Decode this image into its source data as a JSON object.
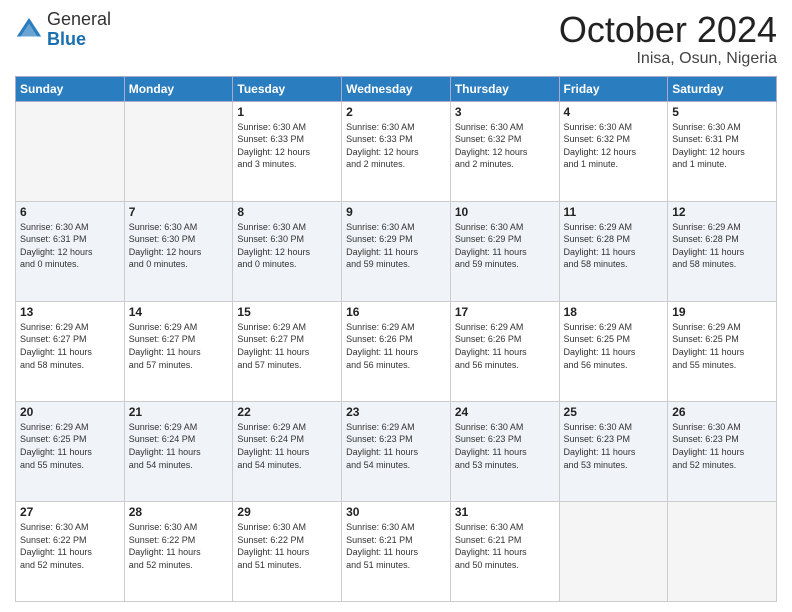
{
  "header": {
    "logo_general": "General",
    "logo_blue": "Blue",
    "title": "October 2024",
    "location": "Inisa, Osun, Nigeria"
  },
  "weekdays": [
    "Sunday",
    "Monday",
    "Tuesday",
    "Wednesday",
    "Thursday",
    "Friday",
    "Saturday"
  ],
  "weeks": [
    [
      {
        "num": "",
        "info": ""
      },
      {
        "num": "",
        "info": ""
      },
      {
        "num": "1",
        "info": "Sunrise: 6:30 AM\nSunset: 6:33 PM\nDaylight: 12 hours\nand 3 minutes."
      },
      {
        "num": "2",
        "info": "Sunrise: 6:30 AM\nSunset: 6:33 PM\nDaylight: 12 hours\nand 2 minutes."
      },
      {
        "num": "3",
        "info": "Sunrise: 6:30 AM\nSunset: 6:32 PM\nDaylight: 12 hours\nand 2 minutes."
      },
      {
        "num": "4",
        "info": "Sunrise: 6:30 AM\nSunset: 6:32 PM\nDaylight: 12 hours\nand 1 minute."
      },
      {
        "num": "5",
        "info": "Sunrise: 6:30 AM\nSunset: 6:31 PM\nDaylight: 12 hours\nand 1 minute."
      }
    ],
    [
      {
        "num": "6",
        "info": "Sunrise: 6:30 AM\nSunset: 6:31 PM\nDaylight: 12 hours\nand 0 minutes."
      },
      {
        "num": "7",
        "info": "Sunrise: 6:30 AM\nSunset: 6:30 PM\nDaylight: 12 hours\nand 0 minutes."
      },
      {
        "num": "8",
        "info": "Sunrise: 6:30 AM\nSunset: 6:30 PM\nDaylight: 12 hours\nand 0 minutes."
      },
      {
        "num": "9",
        "info": "Sunrise: 6:30 AM\nSunset: 6:29 PM\nDaylight: 11 hours\nand 59 minutes."
      },
      {
        "num": "10",
        "info": "Sunrise: 6:30 AM\nSunset: 6:29 PM\nDaylight: 11 hours\nand 59 minutes."
      },
      {
        "num": "11",
        "info": "Sunrise: 6:29 AM\nSunset: 6:28 PM\nDaylight: 11 hours\nand 58 minutes."
      },
      {
        "num": "12",
        "info": "Sunrise: 6:29 AM\nSunset: 6:28 PM\nDaylight: 11 hours\nand 58 minutes."
      }
    ],
    [
      {
        "num": "13",
        "info": "Sunrise: 6:29 AM\nSunset: 6:27 PM\nDaylight: 11 hours\nand 58 minutes."
      },
      {
        "num": "14",
        "info": "Sunrise: 6:29 AM\nSunset: 6:27 PM\nDaylight: 11 hours\nand 57 minutes."
      },
      {
        "num": "15",
        "info": "Sunrise: 6:29 AM\nSunset: 6:27 PM\nDaylight: 11 hours\nand 57 minutes."
      },
      {
        "num": "16",
        "info": "Sunrise: 6:29 AM\nSunset: 6:26 PM\nDaylight: 11 hours\nand 56 minutes."
      },
      {
        "num": "17",
        "info": "Sunrise: 6:29 AM\nSunset: 6:26 PM\nDaylight: 11 hours\nand 56 minutes."
      },
      {
        "num": "18",
        "info": "Sunrise: 6:29 AM\nSunset: 6:25 PM\nDaylight: 11 hours\nand 56 minutes."
      },
      {
        "num": "19",
        "info": "Sunrise: 6:29 AM\nSunset: 6:25 PM\nDaylight: 11 hours\nand 55 minutes."
      }
    ],
    [
      {
        "num": "20",
        "info": "Sunrise: 6:29 AM\nSunset: 6:25 PM\nDaylight: 11 hours\nand 55 minutes."
      },
      {
        "num": "21",
        "info": "Sunrise: 6:29 AM\nSunset: 6:24 PM\nDaylight: 11 hours\nand 54 minutes."
      },
      {
        "num": "22",
        "info": "Sunrise: 6:29 AM\nSunset: 6:24 PM\nDaylight: 11 hours\nand 54 minutes."
      },
      {
        "num": "23",
        "info": "Sunrise: 6:29 AM\nSunset: 6:23 PM\nDaylight: 11 hours\nand 54 minutes."
      },
      {
        "num": "24",
        "info": "Sunrise: 6:30 AM\nSunset: 6:23 PM\nDaylight: 11 hours\nand 53 minutes."
      },
      {
        "num": "25",
        "info": "Sunrise: 6:30 AM\nSunset: 6:23 PM\nDaylight: 11 hours\nand 53 minutes."
      },
      {
        "num": "26",
        "info": "Sunrise: 6:30 AM\nSunset: 6:23 PM\nDaylight: 11 hours\nand 52 minutes."
      }
    ],
    [
      {
        "num": "27",
        "info": "Sunrise: 6:30 AM\nSunset: 6:22 PM\nDaylight: 11 hours\nand 52 minutes."
      },
      {
        "num": "28",
        "info": "Sunrise: 6:30 AM\nSunset: 6:22 PM\nDaylight: 11 hours\nand 52 minutes."
      },
      {
        "num": "29",
        "info": "Sunrise: 6:30 AM\nSunset: 6:22 PM\nDaylight: 11 hours\nand 51 minutes."
      },
      {
        "num": "30",
        "info": "Sunrise: 6:30 AM\nSunset: 6:21 PM\nDaylight: 11 hours\nand 51 minutes."
      },
      {
        "num": "31",
        "info": "Sunrise: 6:30 AM\nSunset: 6:21 PM\nDaylight: 11 hours\nand 50 minutes."
      },
      {
        "num": "",
        "info": ""
      },
      {
        "num": "",
        "info": ""
      }
    ]
  ]
}
